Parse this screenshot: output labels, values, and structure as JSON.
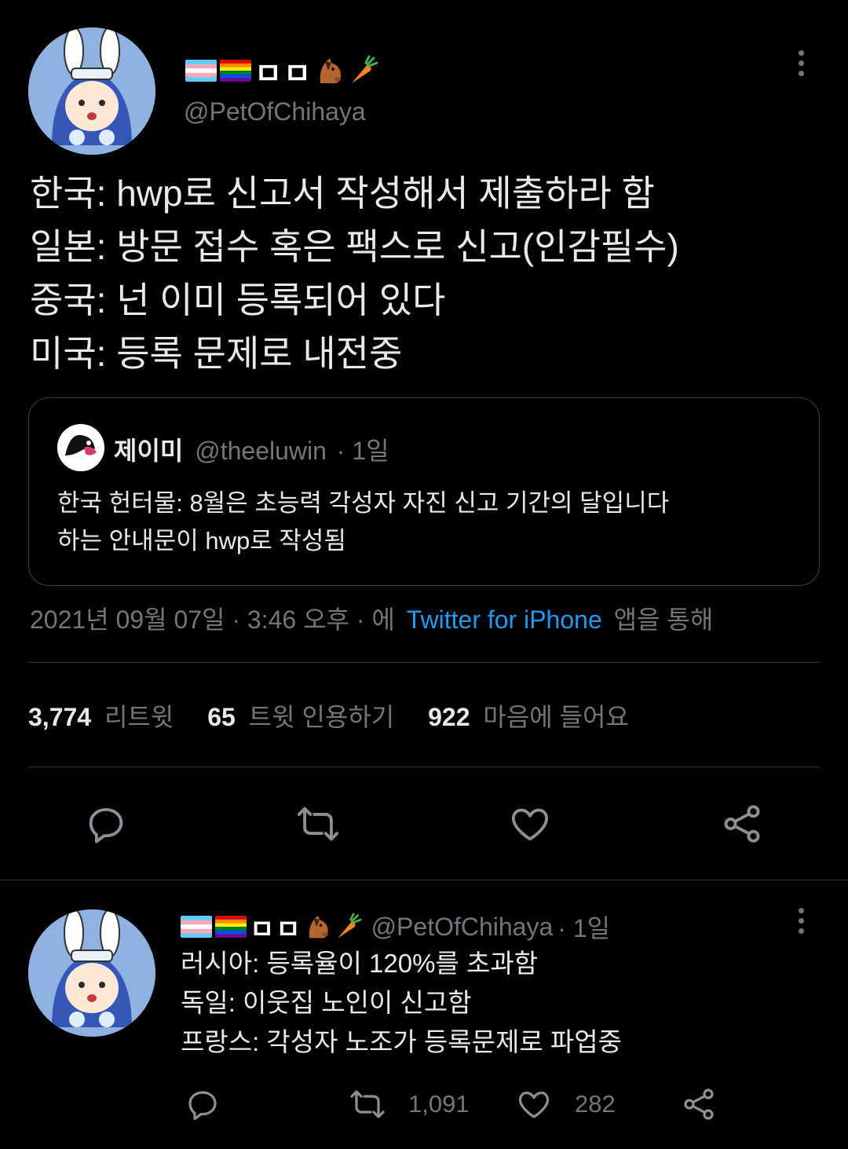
{
  "main_tweet": {
    "display_name_text": "ㅁㅁ",
    "handle": "@PetOfChihaya",
    "lines": [
      "한국: hwp로 신고서 작성해서 제출하라 함",
      "일본: 방문 접수 혹은 팩스로 신고(인감필수)",
      "중국: 넌 이미 등록되어 있다",
      "미국: 등록 문제로 내전중"
    ],
    "quote": {
      "name": "제이미",
      "handle": "@theeluwin",
      "time": "· 1일",
      "text_lines": [
        "한국 헌터물: 8월은 초능력 각성자 자진 신고 기간의 달입니다",
        "하는 안내문이 hwp로 작성됨"
      ]
    },
    "meta": {
      "datetime": "2021년 09월 07일 · 3:46 오후 · 에",
      "source": "Twitter for iPhone",
      "suffix": "앱을 통해"
    },
    "stats": {
      "retweets_count": "3,774",
      "retweets_label": "리트윗",
      "quotes_count": "65",
      "quotes_label": "트윗 인용하기",
      "likes_count": "922",
      "likes_label": "마음에 들어요"
    }
  },
  "reply_tweet": {
    "display_name_text": "ㅁㅁ",
    "handle": "@PetOfChihaya",
    "time": "· 1일",
    "lines": [
      "러시아: 등록율이 120%를 초과함",
      "독일: 이웃집 노인이 신고함",
      "프랑스: 각성자 노조가 등록문제로 파업중"
    ],
    "retweets": "1,091",
    "likes": "282"
  },
  "colors": {
    "background": "#000000",
    "text": "#e7e9ea",
    "muted": "#71767b",
    "link": "#1d9bf0",
    "border": "#2f3336"
  },
  "icons": {
    "trans_flag": "trans-flag-icon",
    "rainbow_flag": "rainbow-flag-icon",
    "horse": "horse-face-icon",
    "carrot": "carrot-icon",
    "more": "more-vertical-icon",
    "reply": "reply-icon",
    "retweet": "retweet-icon",
    "like": "heart-icon",
    "share": "share-icon"
  }
}
